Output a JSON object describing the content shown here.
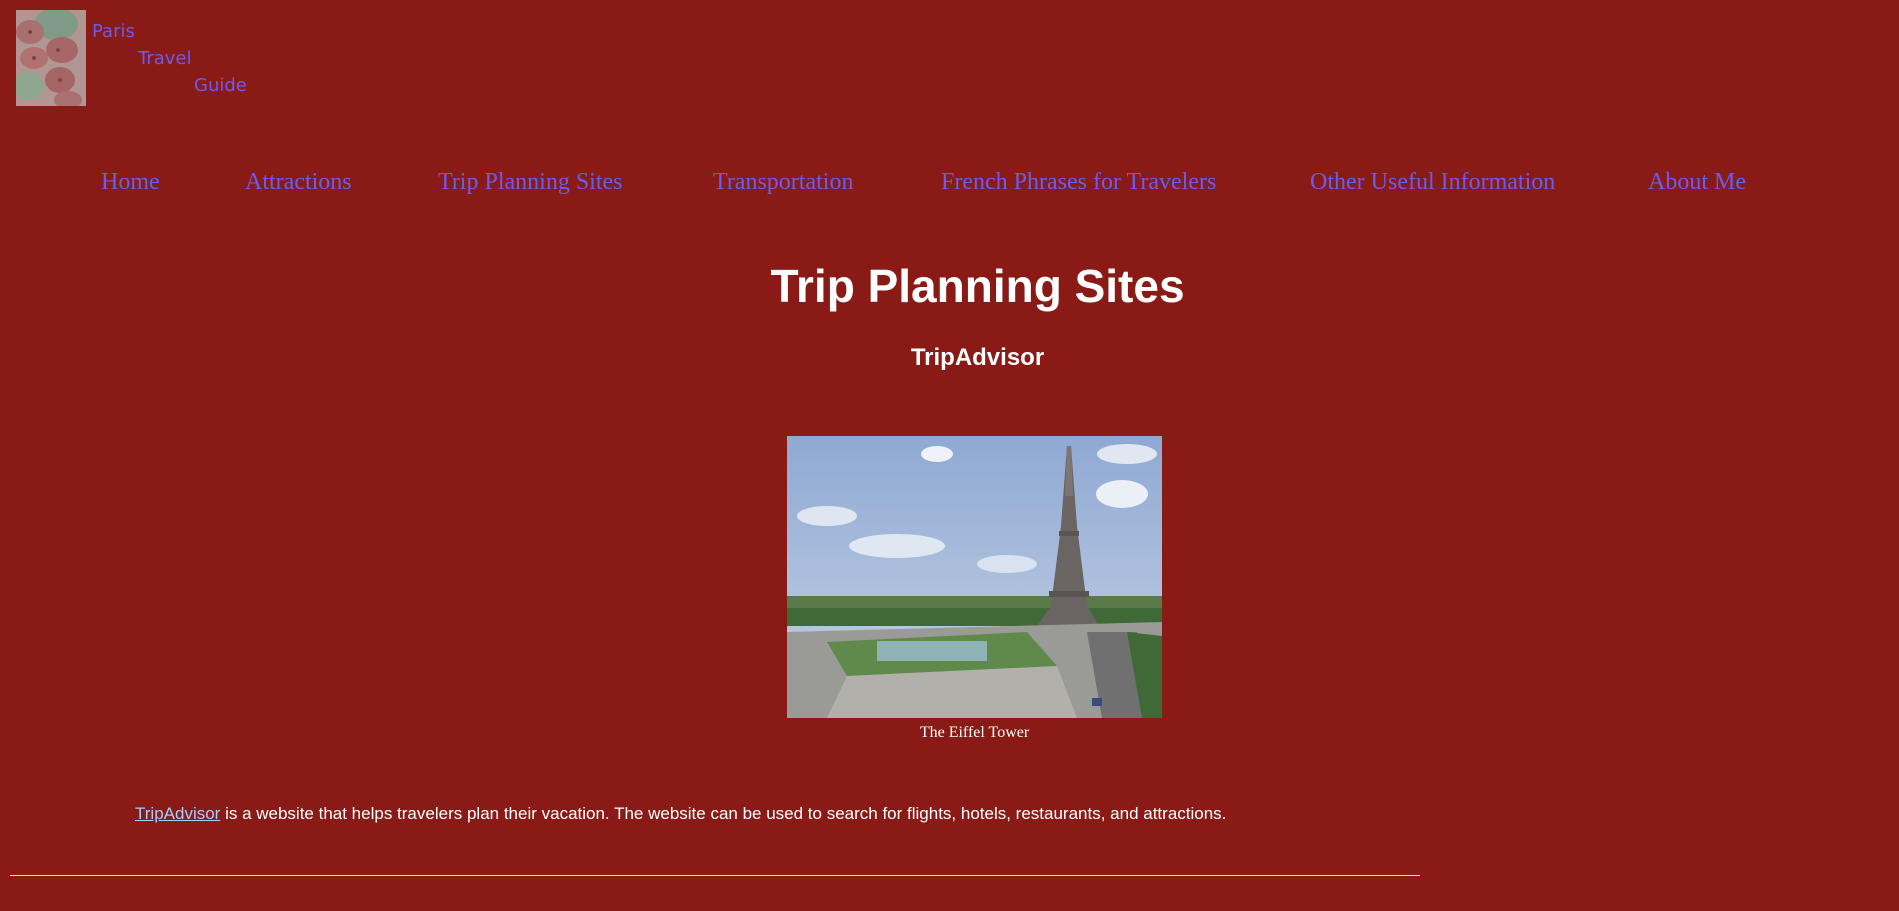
{
  "logo": {
    "line1": "Paris",
    "line2": "Travel",
    "line3": "Guide",
    "icon": "macarons-image"
  },
  "nav": [
    {
      "label": "Home"
    },
    {
      "label": "Attractions"
    },
    {
      "label": "Trip Planning Sites"
    },
    {
      "label": "Transportation"
    },
    {
      "label": "French Phrases for Travelers"
    },
    {
      "label": "Other Useful Information"
    },
    {
      "label": "About Me"
    }
  ],
  "main": {
    "title": "Trip Planning Sites",
    "section_title": "TripAdvisor",
    "image_caption": "The Eiffel Tower",
    "paragraph_link": "TripAdvisor",
    "paragraph_text": " is a website that helps travelers plan their vacation. The website can be used to search for flights, hotels, restaurants, and attractions."
  },
  "colors": {
    "background": "#8a1a15",
    "link": "#6b5cf0",
    "text": "#ffffff",
    "inline_link": "#9fd0ff"
  }
}
